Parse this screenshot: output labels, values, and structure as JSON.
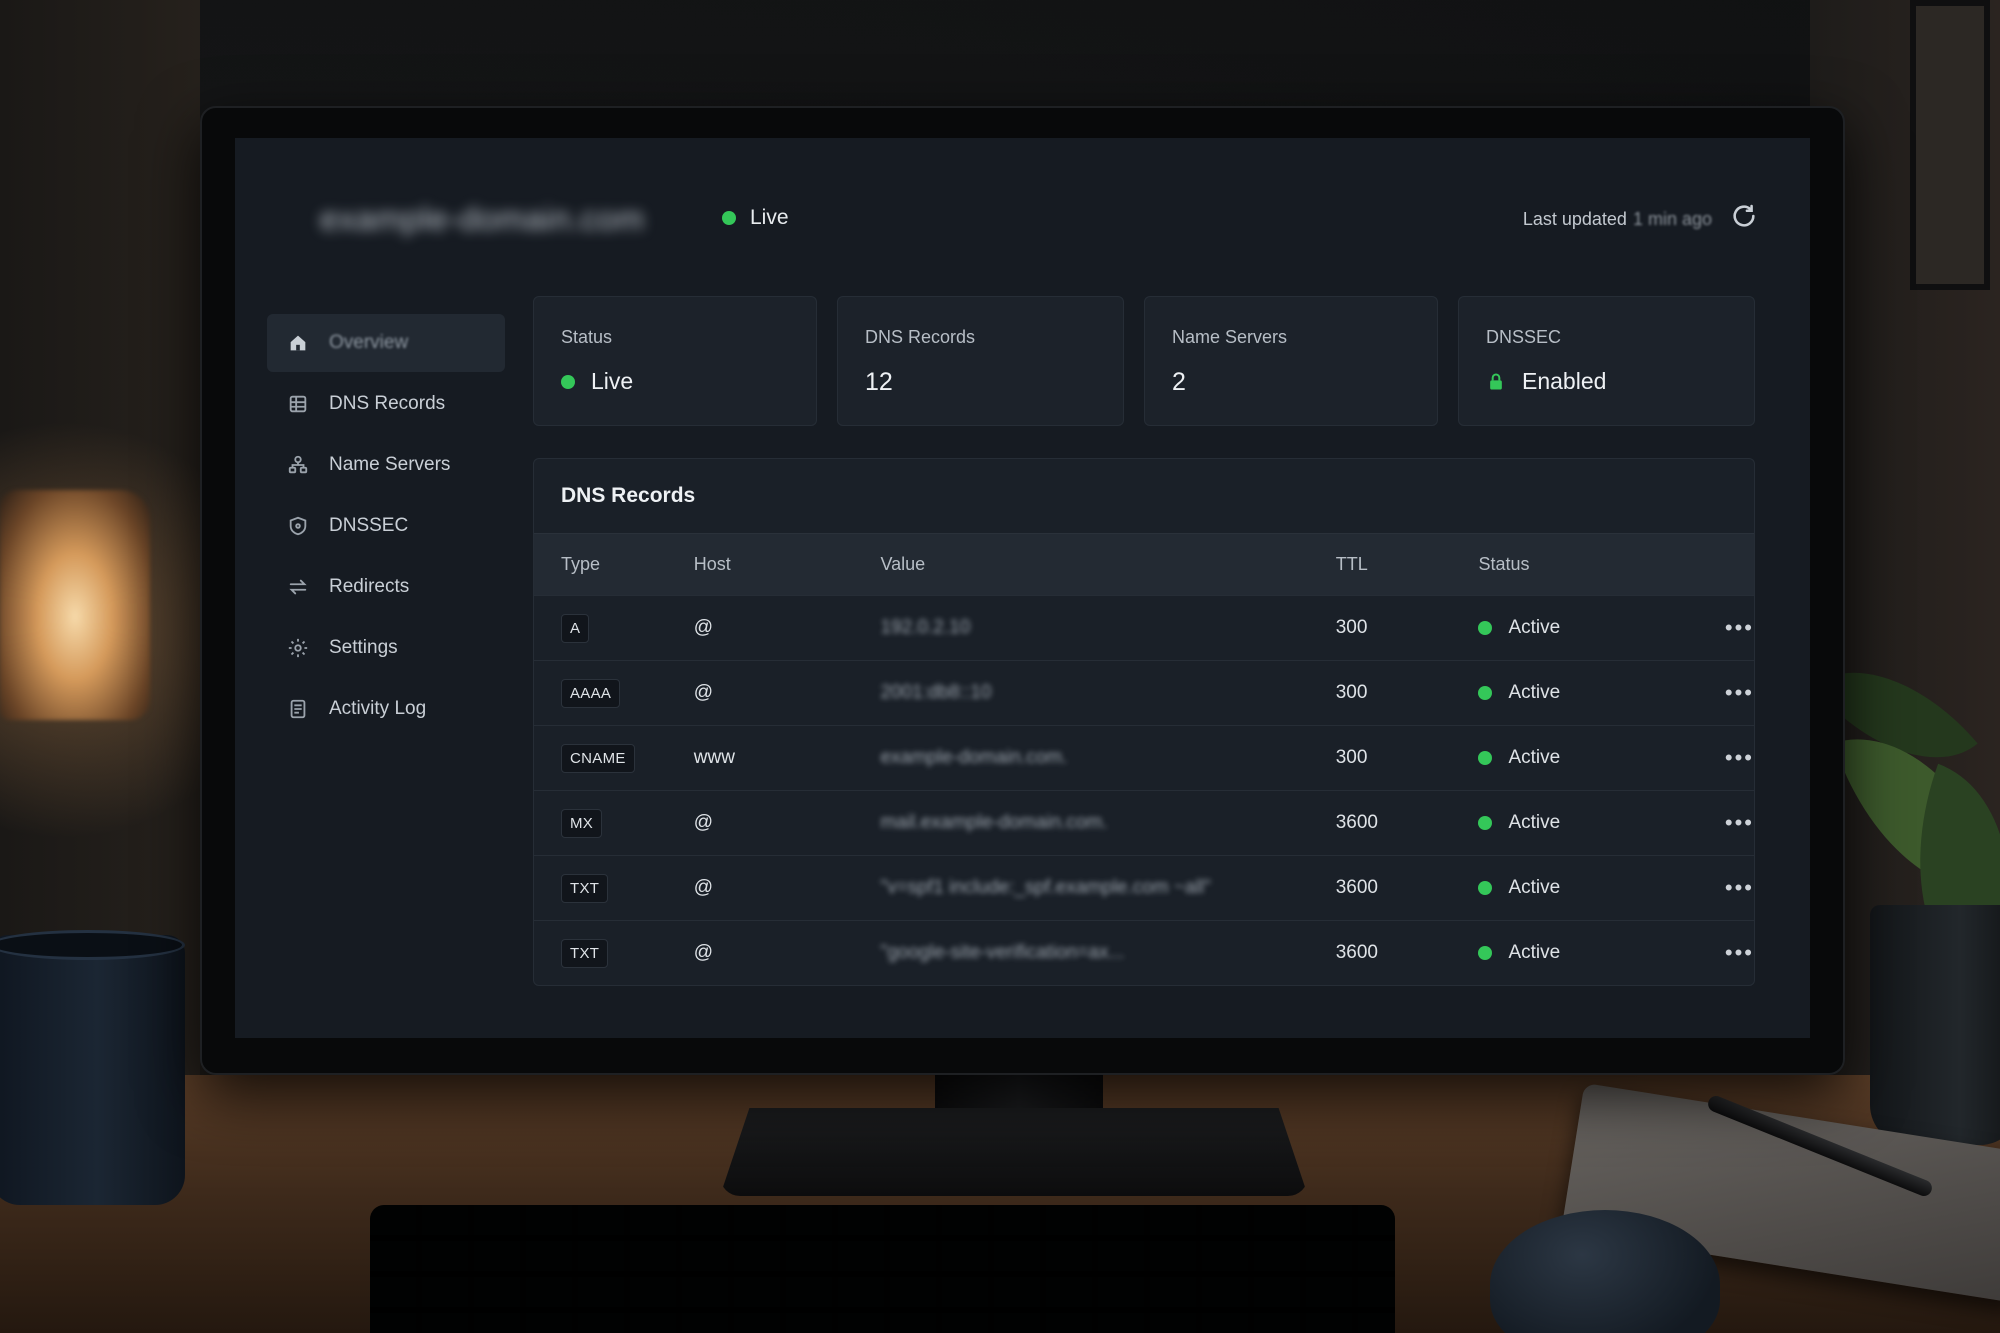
{
  "header": {
    "domain": "example-domain.com",
    "live_label": "Live",
    "last_updated_label": "Last updated",
    "last_updated_value": "1 min ago"
  },
  "colors": {
    "status_green": "#34c759",
    "accent": "#34c759",
    "background": "#161b22"
  },
  "sidebar": {
    "items": [
      {
        "label": "Overview",
        "icon": "home-icon",
        "active": true
      },
      {
        "label": "DNS Records",
        "icon": "dns-records-icon",
        "active": false
      },
      {
        "label": "Name Servers",
        "icon": "name-servers-icon",
        "active": false
      },
      {
        "label": "DNSSEC",
        "icon": "shield-icon",
        "active": false
      },
      {
        "label": "Redirects",
        "icon": "redirect-arrows-icon",
        "active": false
      },
      {
        "label": "Settings",
        "icon": "gear-icon",
        "active": false
      },
      {
        "label": "Activity Log",
        "icon": "activity-log-icon",
        "active": false
      }
    ]
  },
  "stats": [
    {
      "label": "Status",
      "value": "Live"
    },
    {
      "label": "DNS Records",
      "value": "12"
    },
    {
      "label": "Name Servers",
      "value": "2"
    },
    {
      "label": "DNSSEC",
      "value": "Enabled"
    }
  ],
  "records": {
    "title": "DNS Records",
    "columns": [
      "Type",
      "Host",
      "Value",
      "TTL",
      "Status"
    ],
    "rows": [
      {
        "type": "A",
        "host": "@",
        "value": "192.0.2.10",
        "ttl": "300",
        "status": "Active"
      },
      {
        "type": "AAAA",
        "host": "@",
        "value": "2001:db8::10",
        "ttl": "300",
        "status": "Active"
      },
      {
        "type": "CNAME",
        "host": "www",
        "value": "example-domain.com.",
        "ttl": "300",
        "status": "Active"
      },
      {
        "type": "MX",
        "host": "@",
        "value": "mail.example-domain.com.",
        "ttl": "3600",
        "status": "Active"
      },
      {
        "type": "TXT",
        "host": "@",
        "value": "\"v=spf1 include:_spf.example.com ~all\"",
        "ttl": "3600",
        "status": "Active"
      },
      {
        "type": "TXT",
        "host": "@",
        "value": "\"google-site-verification=ax...",
        "ttl": "3600",
        "status": "Active"
      }
    ],
    "row_menu_glyph": "•••"
  }
}
